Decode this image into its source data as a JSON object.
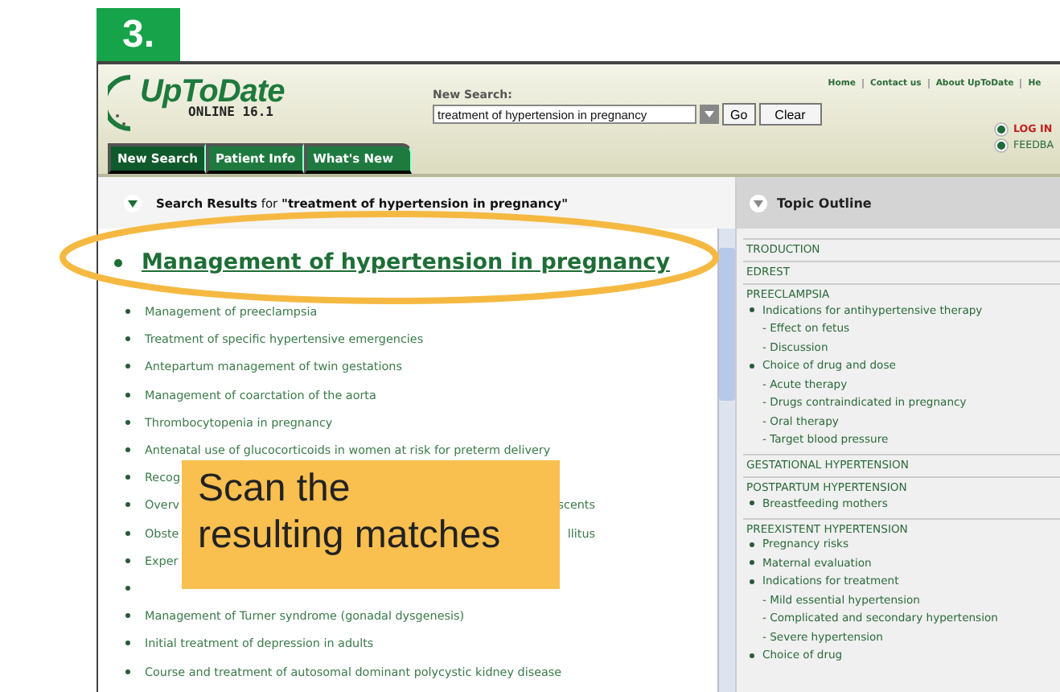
{
  "step": "3.",
  "header": {
    "logo_name": "UpToDate",
    "edition": "ONLINE 16.1",
    "search_label": "New Search:",
    "search": {
      "value": "treatment of hypertension in pregnancy"
    },
    "buttons": [
      "Go",
      "Clear"
    ],
    "links": [
      "Home",
      "Contact us",
      "About UpToDate",
      "He"
    ],
    "actions": [
      {
        "label": "LOG IN",
        "kind": "alert"
      },
      {
        "label": "FEEDBA",
        "kind": "normal"
      }
    ],
    "tabs": [
      {
        "label": "New Search",
        "selected": true
      },
      {
        "label": "Patient Info",
        "selected": false
      },
      {
        "label": "What's New",
        "selected": false
      }
    ]
  },
  "results": {
    "heading": "**Search Results** for **\"treatment of hypertension in pregnancy\"**",
    "top_result": "Management of hypertension in pregnancy",
    "rows": [
      {
        "start": "Management of preeclampsia"
      },
      {
        "start": "Treatment of specific hypertensive emergencies"
      },
      {
        "start": "Antepartum management of twin gestations"
      },
      {
        "start": "Management of coarctation of the aorta"
      },
      {
        "start": "Thrombocytopenia in pregnancy"
      },
      {
        "start": "Antenatal use of glucocorticoids in women at risk for preterm delivery"
      },
      {
        "start": "Recog"
      },
      {
        "start": "Overv",
        "end": "scents"
      },
      {
        "start": "Obste",
        "end": "llitus"
      },
      {
        "start": "Exper"
      },
      {},
      {
        "start": "Management of Turner syndrome (gonadal dysgenesis)"
      },
      {
        "start": "Initial treatment of depression in adults"
      },
      {
        "start": "Course and treatment of autosomal dominant polycystic kidney disease"
      }
    ]
  },
  "outline": {
    "title": "Topic Outline",
    "sections": [
      {
        "title": "TRODUCTION"
      },
      {
        "title": "EDREST"
      },
      {
        "title": "PREECLAMPSIA",
        "items": [
          {
            "text": "Indications for antihypertensive therapy",
            "children": [
              "- Effect on fetus",
              "- Discussion"
            ]
          },
          {
            "text": "Choice of drug and dose",
            "children": [
              "- Acute therapy",
              "- Drugs contraindicated in pregnancy",
              "- Oral therapy",
              "- Target blood pressure"
            ]
          }
        ]
      },
      {
        "title": "GESTATIONAL HYPERTENSION"
      },
      {
        "title": "POSTPARTUM HYPERTENSION",
        "items": [
          {
            "text": "Breastfeeding mothers"
          }
        ]
      },
      {
        "title": "PREEXISTENT HYPERTENSION",
        "items": [
          {
            "text": "Pregnancy risks"
          },
          {
            "text": "Maternal evaluation"
          },
          {
            "text": "Indications for treatment",
            "children": [
              "- Mild essential hypertension",
              "- Complicated and secondary hypertension",
              "- Severe hypertension"
            ]
          },
          {
            "text": "Choice of drug"
          }
        ]
      }
    ]
  },
  "callout": "Scan the\nresulting matches"
}
